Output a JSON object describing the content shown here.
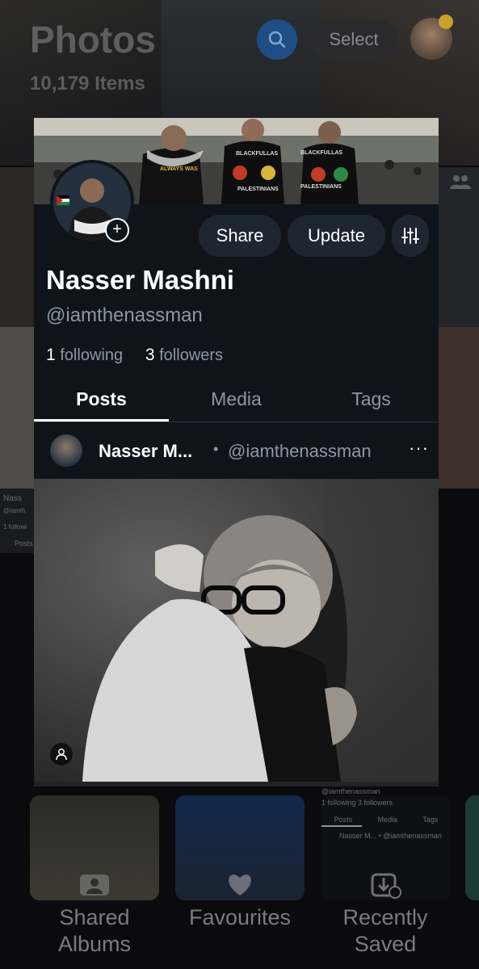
{
  "background": {
    "title": "Photos",
    "items_count": "10,179 Items",
    "select_label": "Select",
    "collections": [
      {
        "label": "Shared\nAlbums",
        "icon": "shared-albums-icon"
      },
      {
        "label": "Favourites",
        "icon": "heart-icon"
      },
      {
        "label": "Recently\nSaved",
        "icon": "download-icon"
      }
    ],
    "mini_profile": {
      "handle": "@iamthenassman",
      "stats": "1 following  3 followers",
      "tabs": [
        "Posts",
        "Media",
        "Tags"
      ],
      "post": "Nasser M... • @iamthenassman"
    },
    "left_mini": {
      "name": "Nass",
      "handle": "@iamth",
      "stats": "1 followi",
      "tab": "Posts"
    }
  },
  "profile": {
    "banner_text": [
      "BLACKFULLAS",
      "PALESTINIANS",
      "BLACKFULLAS",
      "PALESTINIANS",
      "ALWAYS WAS"
    ],
    "share_label": "Share",
    "update_label": "Update",
    "display_name": "Nasser Mashni",
    "handle": "@iamthenassman",
    "following_count": "1",
    "following_label": "following",
    "followers_count": "3",
    "followers_label": "followers",
    "tabs": [
      {
        "label": "Posts",
        "active": true
      },
      {
        "label": "Media",
        "active": false
      },
      {
        "label": "Tags",
        "active": false
      }
    ],
    "post": {
      "author_name": "Nasser M...",
      "separator": "•",
      "author_handle": "@iamthenassman",
      "more": "···"
    }
  },
  "colors": {
    "card_bg": "#0f141a",
    "pill_bg": "#1e2731",
    "muted_text": "#8b98a5",
    "search_accent": "#1f4e86"
  }
}
